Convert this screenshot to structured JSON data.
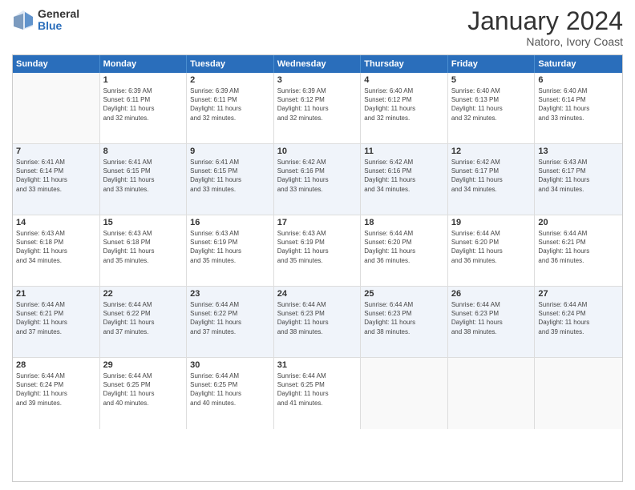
{
  "logo": {
    "general": "General",
    "blue": "Blue"
  },
  "title": "January 2024",
  "location": "Natoro, Ivory Coast",
  "days": [
    "Sunday",
    "Monday",
    "Tuesday",
    "Wednesday",
    "Thursday",
    "Friday",
    "Saturday"
  ],
  "weeks": [
    [
      {
        "day": "",
        "info": ""
      },
      {
        "day": "1",
        "info": "Sunrise: 6:39 AM\nSunset: 6:11 PM\nDaylight: 11 hours\nand 32 minutes."
      },
      {
        "day": "2",
        "info": "Sunrise: 6:39 AM\nSunset: 6:11 PM\nDaylight: 11 hours\nand 32 minutes."
      },
      {
        "day": "3",
        "info": "Sunrise: 6:39 AM\nSunset: 6:12 PM\nDaylight: 11 hours\nand 32 minutes."
      },
      {
        "day": "4",
        "info": "Sunrise: 6:40 AM\nSunset: 6:12 PM\nDaylight: 11 hours\nand 32 minutes."
      },
      {
        "day": "5",
        "info": "Sunrise: 6:40 AM\nSunset: 6:13 PM\nDaylight: 11 hours\nand 32 minutes."
      },
      {
        "day": "6",
        "info": "Sunrise: 6:40 AM\nSunset: 6:14 PM\nDaylight: 11 hours\nand 33 minutes."
      }
    ],
    [
      {
        "day": "7",
        "info": "Sunrise: 6:41 AM\nSunset: 6:14 PM\nDaylight: 11 hours\nand 33 minutes."
      },
      {
        "day": "8",
        "info": "Sunrise: 6:41 AM\nSunset: 6:15 PM\nDaylight: 11 hours\nand 33 minutes."
      },
      {
        "day": "9",
        "info": "Sunrise: 6:41 AM\nSunset: 6:15 PM\nDaylight: 11 hours\nand 33 minutes."
      },
      {
        "day": "10",
        "info": "Sunrise: 6:42 AM\nSunset: 6:16 PM\nDaylight: 11 hours\nand 33 minutes."
      },
      {
        "day": "11",
        "info": "Sunrise: 6:42 AM\nSunset: 6:16 PM\nDaylight: 11 hours\nand 34 minutes."
      },
      {
        "day": "12",
        "info": "Sunrise: 6:42 AM\nSunset: 6:17 PM\nDaylight: 11 hours\nand 34 minutes."
      },
      {
        "day": "13",
        "info": "Sunrise: 6:43 AM\nSunset: 6:17 PM\nDaylight: 11 hours\nand 34 minutes."
      }
    ],
    [
      {
        "day": "14",
        "info": "Sunrise: 6:43 AM\nSunset: 6:18 PM\nDaylight: 11 hours\nand 34 minutes."
      },
      {
        "day": "15",
        "info": "Sunrise: 6:43 AM\nSunset: 6:18 PM\nDaylight: 11 hours\nand 35 minutes."
      },
      {
        "day": "16",
        "info": "Sunrise: 6:43 AM\nSunset: 6:19 PM\nDaylight: 11 hours\nand 35 minutes."
      },
      {
        "day": "17",
        "info": "Sunrise: 6:43 AM\nSunset: 6:19 PM\nDaylight: 11 hours\nand 35 minutes."
      },
      {
        "day": "18",
        "info": "Sunrise: 6:44 AM\nSunset: 6:20 PM\nDaylight: 11 hours\nand 36 minutes."
      },
      {
        "day": "19",
        "info": "Sunrise: 6:44 AM\nSunset: 6:20 PM\nDaylight: 11 hours\nand 36 minutes."
      },
      {
        "day": "20",
        "info": "Sunrise: 6:44 AM\nSunset: 6:21 PM\nDaylight: 11 hours\nand 36 minutes."
      }
    ],
    [
      {
        "day": "21",
        "info": "Sunrise: 6:44 AM\nSunset: 6:21 PM\nDaylight: 11 hours\nand 37 minutes."
      },
      {
        "day": "22",
        "info": "Sunrise: 6:44 AM\nSunset: 6:22 PM\nDaylight: 11 hours\nand 37 minutes."
      },
      {
        "day": "23",
        "info": "Sunrise: 6:44 AM\nSunset: 6:22 PM\nDaylight: 11 hours\nand 37 minutes."
      },
      {
        "day": "24",
        "info": "Sunrise: 6:44 AM\nSunset: 6:23 PM\nDaylight: 11 hours\nand 38 minutes."
      },
      {
        "day": "25",
        "info": "Sunrise: 6:44 AM\nSunset: 6:23 PM\nDaylight: 11 hours\nand 38 minutes."
      },
      {
        "day": "26",
        "info": "Sunrise: 6:44 AM\nSunset: 6:23 PM\nDaylight: 11 hours\nand 38 minutes."
      },
      {
        "day": "27",
        "info": "Sunrise: 6:44 AM\nSunset: 6:24 PM\nDaylight: 11 hours\nand 39 minutes."
      }
    ],
    [
      {
        "day": "28",
        "info": "Sunrise: 6:44 AM\nSunset: 6:24 PM\nDaylight: 11 hours\nand 39 minutes."
      },
      {
        "day": "29",
        "info": "Sunrise: 6:44 AM\nSunset: 6:25 PM\nDaylight: 11 hours\nand 40 minutes."
      },
      {
        "day": "30",
        "info": "Sunrise: 6:44 AM\nSunset: 6:25 PM\nDaylight: 11 hours\nand 40 minutes."
      },
      {
        "day": "31",
        "info": "Sunrise: 6:44 AM\nSunset: 6:25 PM\nDaylight: 11 hours\nand 41 minutes."
      },
      {
        "day": "",
        "info": ""
      },
      {
        "day": "",
        "info": ""
      },
      {
        "day": "",
        "info": ""
      }
    ]
  ]
}
